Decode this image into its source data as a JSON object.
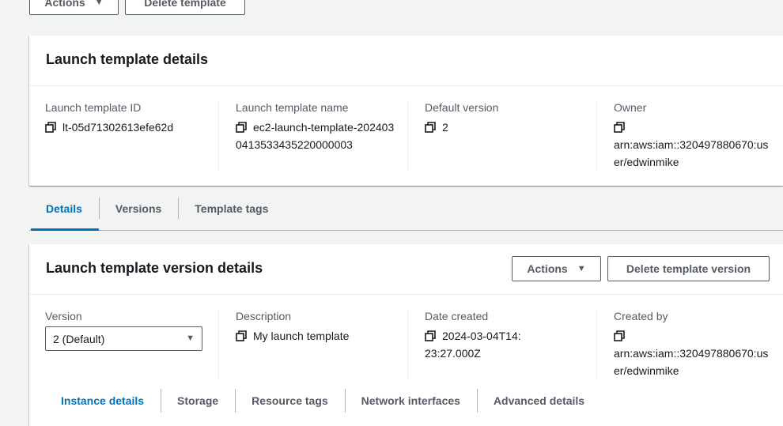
{
  "top_actions": {
    "actions_label": "Actions",
    "delete_label": "Delete template"
  },
  "details_panel": {
    "title": "Launch template details",
    "fields": [
      {
        "label": "Launch template ID",
        "value": "lt-05d71302613efe62d"
      },
      {
        "label": "Launch template name",
        "value": "ec2-launch-template-2024030413533435220000003"
      },
      {
        "label": "Default version",
        "value": "2"
      },
      {
        "label": "Owner",
        "value": "arn:aws:iam::320497880670:user/edwinmike"
      }
    ]
  },
  "tabs": [
    {
      "label": "Details",
      "active": true
    },
    {
      "label": "Versions",
      "active": false
    },
    {
      "label": "Template tags",
      "active": false
    }
  ],
  "version_panel": {
    "title": "Launch template version details",
    "actions_label": "Actions",
    "delete_label": "Delete template version",
    "version_label": "Version",
    "version_selected": "2 (Default)",
    "description_label": "Description",
    "description_value": "My launch template",
    "date_label": "Date created",
    "date_value": "2024-03-04T14:23:27.000Z",
    "created_by_label": "Created by",
    "created_by_value": "arn:aws:iam::320497880670:user/edwinmike"
  },
  "sub_tabs": [
    {
      "label": "Instance details",
      "active": true
    },
    {
      "label": "Storage",
      "active": false
    },
    {
      "label": "Resource tags",
      "active": false
    },
    {
      "label": "Network interfaces",
      "active": false
    },
    {
      "label": "Advanced details",
      "active": false
    }
  ],
  "colors": {
    "accent": "#0073bb",
    "background": "#f2f3f3",
    "text": "#16191f",
    "muted": "#545b64"
  },
  "icons": {
    "copy": "copy-icon",
    "dropdown": "caret-down-icon"
  }
}
